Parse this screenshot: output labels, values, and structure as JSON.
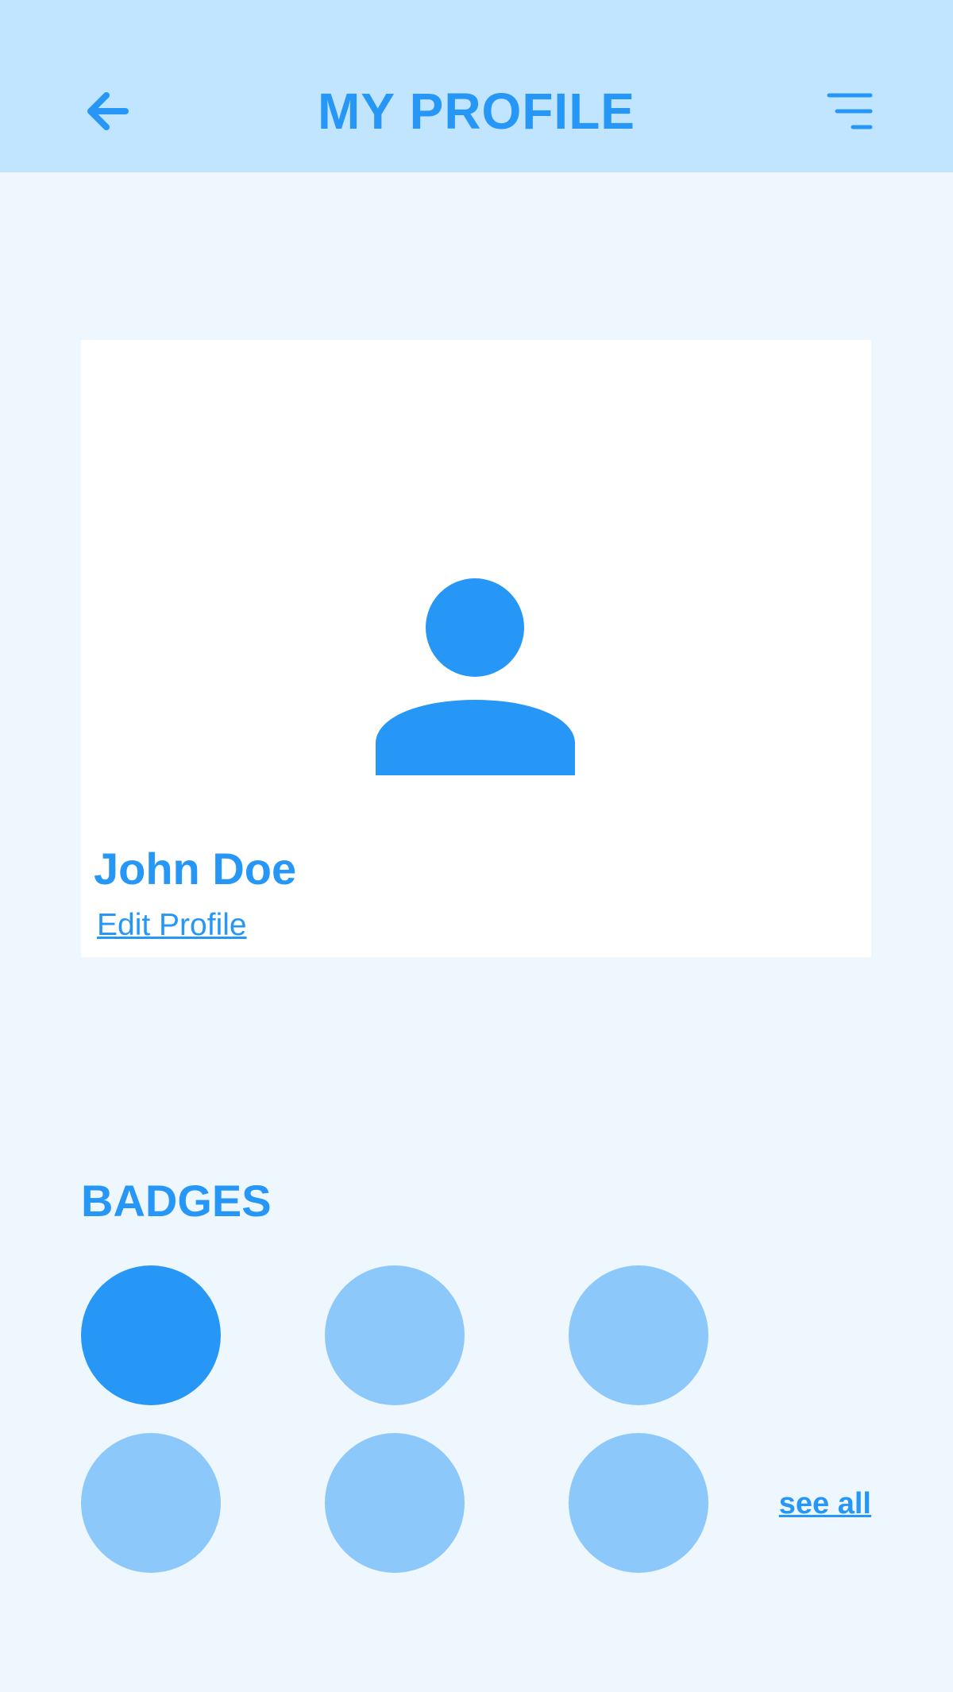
{
  "header": {
    "title": "MY PROFILE",
    "back_icon": "arrow-left-icon",
    "menu_icon": "menu-icon"
  },
  "profile": {
    "avatar_icon": "user-icon",
    "name": "John Doe",
    "edit_label": "Edit Profile"
  },
  "badges": {
    "title": "BADGES",
    "items": [
      {
        "state": "earned"
      },
      {
        "state": "locked"
      },
      {
        "state": "locked"
      },
      {
        "state": "locked"
      },
      {
        "state": "locked"
      },
      {
        "state": "locked"
      }
    ],
    "see_all_label": "see all"
  },
  "colors": {
    "accent": "#2697F7",
    "accent_light": "#8DC8FB",
    "header_bg": "#C1E4FF",
    "page_bg": "#EEF7FE",
    "card_bg": "#FFFFFF"
  }
}
